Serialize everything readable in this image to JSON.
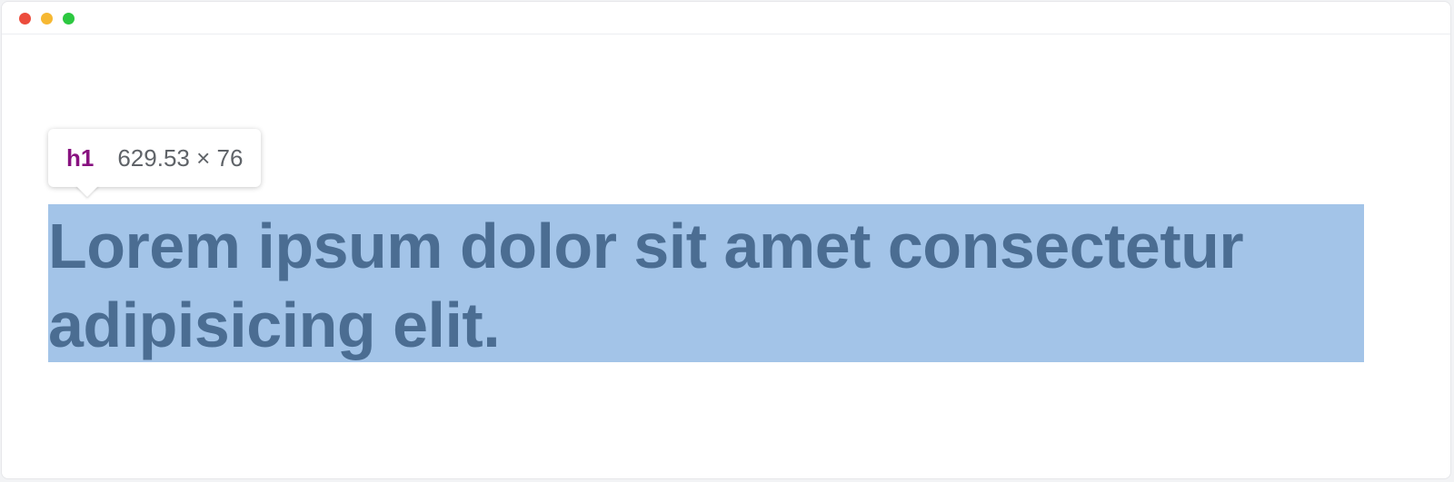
{
  "window": {
    "controls": [
      {
        "name": "close",
        "color": "#ec4c3c"
      },
      {
        "name": "minimize",
        "color": "#f6b832"
      },
      {
        "name": "maximize",
        "color": "#2cc840"
      }
    ]
  },
  "inspector_tooltip": {
    "tag": "h1",
    "dimensions": "629.53 × 76",
    "tag_color": "#881280"
  },
  "heading": {
    "text": "Lorem ipsum dolor sit amet consectetur adipisicing elit.",
    "highlight_color": "#a3c4e8",
    "text_color": "#4b6d92"
  }
}
